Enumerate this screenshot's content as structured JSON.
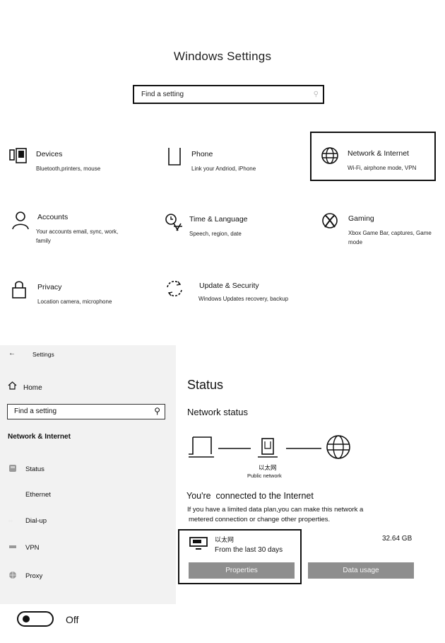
{
  "top": {
    "title": "Windows Settings",
    "search_placeholder": "Find a setting",
    "tiles": [
      {
        "title": "Devices",
        "subtitle": "Bluetooth,printers, mouse",
        "icon": "devices-icon"
      },
      {
        "title": "Phone",
        "subtitle": "Link your Andriod, iPhone",
        "icon": "phone-icon"
      },
      {
        "title": "Network & Internet",
        "subtitle": "Wi-Fi, airphone mode, VPN",
        "icon": "globe-icon"
      },
      {
        "title": "Accounts",
        "subtitle": "Your accounts email, sync, work, family",
        "icon": "person-icon"
      },
      {
        "title": "Time & Language",
        "subtitle": "Speech, region, date",
        "icon": "time-language-icon"
      },
      {
        "title": "Gaming",
        "subtitle": "Xbox Game Bar, captures, Game mode",
        "icon": "xbox-icon"
      },
      {
        "title": "Privacy",
        "subtitle": "Location camera, microphone",
        "icon": "lock-icon"
      },
      {
        "title": "Update & Security",
        "subtitle": "Windows Updates recovery, backup",
        "icon": "sync-icon"
      }
    ]
  },
  "sidebar": {
    "back_label": "Settings",
    "home_label": "Home",
    "search_placeholder": "Find a setting",
    "section_title": "Network & Internet",
    "items": [
      {
        "label": "Status",
        "icon": "status-icon"
      },
      {
        "label": "Ethernet",
        "icon": "ethernet-icon"
      },
      {
        "label": "Dial-up",
        "icon": "dialup-icon"
      },
      {
        "label": "VPN",
        "icon": "vpn-icon"
      },
      {
        "label": "Proxy",
        "icon": "proxy-icon"
      }
    ]
  },
  "main": {
    "page_title": "Status",
    "section_title": "Network status",
    "network_name": "以太网",
    "network_type": "Public network",
    "connected_text": "You're  connected to the Internet",
    "info_line1": "If you have a limited data plan,you can make this network a",
    "info_line2": "metered connection or change other properties.",
    "usage": {
      "name": "以太网",
      "period": "From the last 30 days",
      "amount": "32.64 GB"
    },
    "properties_button": "Properties",
    "data_usage_button": "Data usage"
  },
  "toggle": {
    "label": "Off",
    "state": "off"
  }
}
